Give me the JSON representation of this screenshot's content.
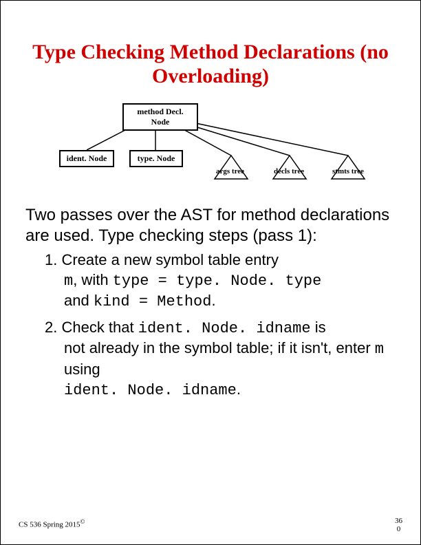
{
  "title": "Type Checking Method Declarations (no Overloading)",
  "diagram": {
    "root": "method Decl. Node",
    "children": {
      "box1": "ident. Node",
      "box2": "type. Node",
      "tri1": "args tree",
      "tri2": "decls tree",
      "tri3": "stmts tree"
    }
  },
  "body": {
    "p1": "Two passes over the AST for method declarations are used. Type checking steps (pass 1):",
    "item1_lead": "1. Create a new symbol table entry",
    "item1_m": "m",
    "item1_with": ", with ",
    "item1_eq1_lhs": "type",
    "item1_eq1_eq": " = ",
    "item1_eq1_rhs": "type. Node. type",
    "item1_and": "and ",
    "item1_eq2_lhs": "kind",
    "item1_eq2_eq": " = ",
    "item1_eq2_rhs": "Method",
    "item1_period": ".",
    "item2_lead": "2. Check that ",
    "item2_idname": "ident. Node. idname",
    "item2_is": " is",
    "item2_cont1": "not already in the symbol table; if it isn't, enter ",
    "item2_m": "m",
    "item2_using": " using",
    "item2_final": "ident. Node. idname",
    "item2_period": "."
  },
  "footer": {
    "left": "CS 536  Spring 2015",
    "copy": "©",
    "page_top": "36",
    "page_bot": "0"
  }
}
